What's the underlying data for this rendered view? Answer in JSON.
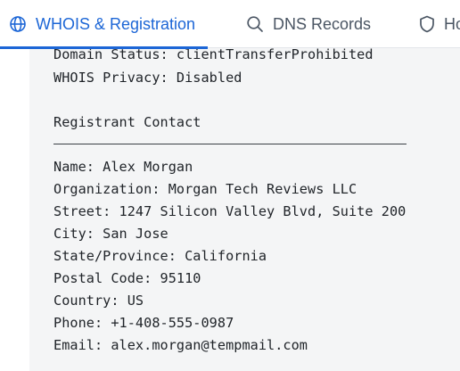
{
  "tabs": [
    {
      "label": "WHOIS & Registration",
      "icon": "globe-icon",
      "active": true
    },
    {
      "label": "DNS Records",
      "icon": "search-icon",
      "active": false
    },
    {
      "label": "Ho",
      "icon": "shield-icon",
      "active": false
    }
  ],
  "colors": {
    "accent": "#1c66d6",
    "inactive_tab": "#4a5563",
    "panel_bg": "#f4f5f6",
    "text": "#1f2328"
  },
  "report": {
    "domain_status": "Domain Status: clientTransferProhibited",
    "whois_privacy": "WHOIS Privacy: Disabled",
    "section_title": "Registrant Contact",
    "contact": [
      "Name: Alex Morgan",
      "Organization: Morgan Tech Reviews LLC",
      "Street: 1247 Silicon Valley Blvd, Suite 200",
      "City: San Jose",
      "State/Province: California",
      "Postal Code: 95110",
      "Country: US",
      "Phone: +1-408-555-0987",
      "Email: alex.morgan@tempmail.com"
    ]
  }
}
